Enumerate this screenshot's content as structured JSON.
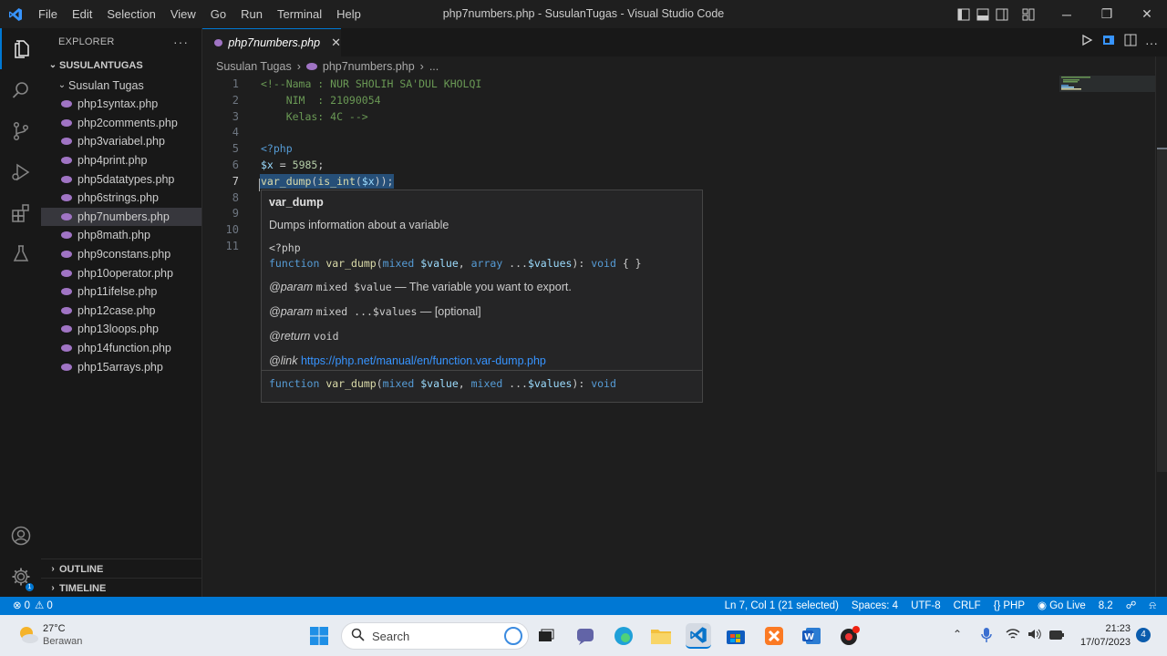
{
  "titlebar": {
    "menus": [
      "File",
      "Edit",
      "Selection",
      "View",
      "Go",
      "Run",
      "Terminal",
      "Help"
    ],
    "title": "php7numbers.php - SusulanTugas - Visual Studio Code"
  },
  "sidebar": {
    "title": "EXPLORER",
    "workspace": "SUSULANTUGAS",
    "folder": "Susulan Tugas",
    "files": [
      "php1syntax.php",
      "php2comments.php",
      "php3variabel.php",
      "php4print.php",
      "php5datatypes.php",
      "php6strings.php",
      "php7numbers.php",
      "php8math.php",
      "php9constans.php",
      "php10operator.php",
      "php11ifelse.php",
      "php12case.php",
      "php13loops.php",
      "php14function.php",
      "php15arrays.php"
    ],
    "active_file_index": 6,
    "outline": "OUTLINE",
    "timeline": "TIMELINE"
  },
  "tab": {
    "label": "php7numbers.php",
    "close": "✕"
  },
  "breadcrumb": {
    "folder": "Susulan Tugas",
    "file": "php7numbers.php",
    "more": "..."
  },
  "editor": {
    "line_numbers": [
      "1",
      "2",
      "3",
      "4",
      "5",
      "6",
      "7",
      "8",
      "9",
      "10",
      "11"
    ],
    "current_line": 7,
    "lines": {
      "l1": "<!--Nama : NUR SHOLIH SA'DUL KHOLQI",
      "l2": "    NIM  : 21090054",
      "l3": "    Kelas: 4C -->",
      "l5": "<?php",
      "l6_var": "$x",
      "l6_eq": " = ",
      "l6_num": "5985",
      "l6_end": ";",
      "l7_fn1": "var_dump",
      "l7_p1": "(",
      "l7_fn2": "is_int",
      "l7_p2": "(",
      "l7_var": "$x",
      "l7_end": "));"
    }
  },
  "hover": {
    "name": "var_dump",
    "description": "Dumps information about a variable",
    "php_tag": "<?php",
    "sig_kw": "function",
    "sig_fn": "var_dump",
    "sig_open": "(",
    "sig_t1": "mixed",
    "sig_v1": "$value",
    "sig_comma": ", ",
    "sig_t2": "array",
    "sig_dots": " ...",
    "sig_v2": "$values",
    "sig_close": "): ",
    "sig_ret": "void",
    "sig_body": " { }",
    "param1_tag": "@param",
    "param1_code": "mixed $value",
    "param1_desc": " — The variable you want to export.",
    "param2_tag": "@param",
    "param2_code": "mixed ...$values",
    "param2_desc": " — [optional]",
    "return_tag": "@return",
    "return_code": "void",
    "link_tag": "@link",
    "link_url": "https://php.net/manual/en/function.var-dump.php",
    "sig2_t2": "mixed"
  },
  "statusbar": {
    "errors": "0",
    "warnings": "0",
    "position": "Ln 7, Col 1 (21 selected)",
    "spaces": "Spaces: 4",
    "encoding": "UTF-8",
    "eol": "CRLF",
    "language": "PHP",
    "golive": "Go Live",
    "version": "8.2"
  },
  "taskbar": {
    "weather_temp": "27°C",
    "weather_desc": "Berawan",
    "search_placeholder": "Search",
    "time": "21:23",
    "date": "17/07/2023",
    "notifications": "4"
  },
  "colors": {
    "accent": "#0078d4",
    "php": "#a074c4"
  }
}
